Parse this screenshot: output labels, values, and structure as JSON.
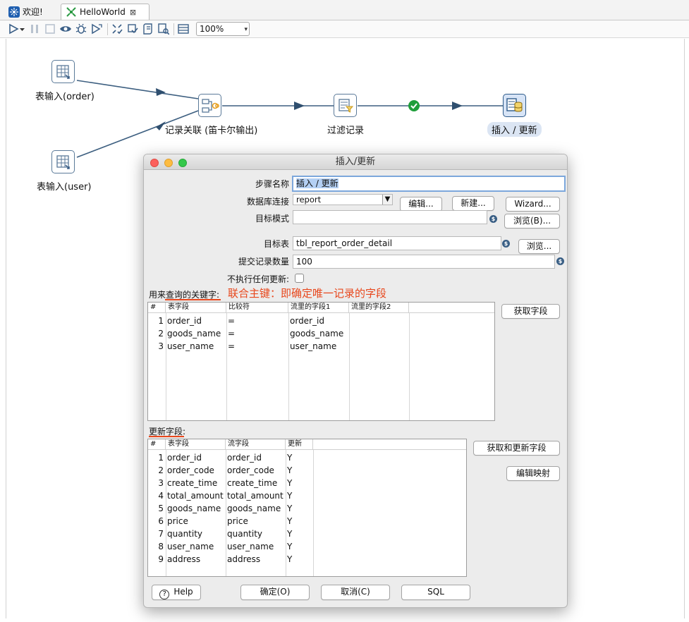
{
  "tabs": [
    {
      "label": "欢迎!"
    },
    {
      "label": "HelloWorld"
    }
  ],
  "toolbar": {
    "zoom": "100%"
  },
  "canvas": {
    "nodes": [
      {
        "label": "表输入(order)"
      },
      {
        "label": "表输入(user)"
      },
      {
        "label": "记录关联 (笛卡尔输出)"
      },
      {
        "label": "过滤记录"
      },
      {
        "label": "插入 / 更新"
      }
    ]
  },
  "dialog": {
    "title": "插入/更新",
    "step_name_label": "步骤名称",
    "step_name_value": "插入 / 更新",
    "db_conn_label": "数据库连接",
    "db_conn_value": "report",
    "edit_button": "编辑...",
    "new_button": "新建...",
    "wizard_button": "Wizard...",
    "target_schema_label": "目标模式",
    "target_schema_value": "",
    "browse_b_button": "浏览(B)...",
    "target_table_label": "目标表",
    "target_table_value": "tbl_report_order_detail",
    "browse_button": "浏览...",
    "commit_count_label": "提交记录数量",
    "commit_count_value": "100",
    "no_update_label": "不执行任何更新:",
    "key_section_label": "用来查询的关键字:",
    "key_annotation": "联合主键：即确定唯一记录的字段",
    "get_fields_button": "获取字段",
    "key_table": {
      "headers": [
        "#",
        "表字段",
        "比较符",
        "流里的字段1",
        "流里的字段2"
      ],
      "rows": [
        {
          "num": "1",
          "table_field": "order_id",
          "comparator": "=",
          "stream1": "order_id",
          "stream2": ""
        },
        {
          "num": "2",
          "table_field": "goods_name",
          "comparator": "=",
          "stream1": "goods_name",
          "stream2": ""
        },
        {
          "num": "3",
          "table_field": "user_name",
          "comparator": "=",
          "stream1": "user_name",
          "stream2": ""
        }
      ]
    },
    "update_section_label": "更新字段:",
    "get_update_fields_button": "获取和更新字段",
    "edit_mapping_button": "编辑映射",
    "update_table": {
      "headers": [
        "#",
        "表字段",
        "流字段",
        "更新"
      ],
      "rows": [
        {
          "num": "1",
          "table_field": "order_id",
          "stream_field": "order_id",
          "update": "Y"
        },
        {
          "num": "2",
          "table_field": "order_code",
          "stream_field": "order_code",
          "update": "Y"
        },
        {
          "num": "3",
          "table_field": "create_time",
          "stream_field": "create_time",
          "update": "Y"
        },
        {
          "num": "4",
          "table_field": "total_amount",
          "stream_field": "total_amount",
          "update": "Y"
        },
        {
          "num": "5",
          "table_field": "goods_name",
          "stream_field": "goods_name",
          "update": "Y"
        },
        {
          "num": "6",
          "table_field": "price",
          "stream_field": "price",
          "update": "Y"
        },
        {
          "num": "7",
          "table_field": "quantity",
          "stream_field": "quantity",
          "update": "Y"
        },
        {
          "num": "8",
          "table_field": "user_name",
          "stream_field": "user_name",
          "update": "Y"
        },
        {
          "num": "9",
          "table_field": "address",
          "stream_field": "address",
          "update": "Y"
        }
      ]
    },
    "help_button": "Help",
    "ok_button": "确定(O)",
    "cancel_button": "取消(C)",
    "sql_button": "SQL"
  },
  "colors": {
    "annotation": "#e8471c",
    "accent": "#2d5a8a",
    "ok_hop": "#1e9e3a"
  },
  "icons": [
    "welcome-icon",
    "transformation-icon",
    "run-icon",
    "pause-icon",
    "stop-icon",
    "preview-icon",
    "debug-icon",
    "replay-icon",
    "verify-icon",
    "impact-icon",
    "sql-icon",
    "explore-db-icon",
    "show-results-icon",
    "table-input-icon",
    "join-icon",
    "filter-icon",
    "insert-update-icon",
    "help-icon",
    "variable-icon"
  ]
}
